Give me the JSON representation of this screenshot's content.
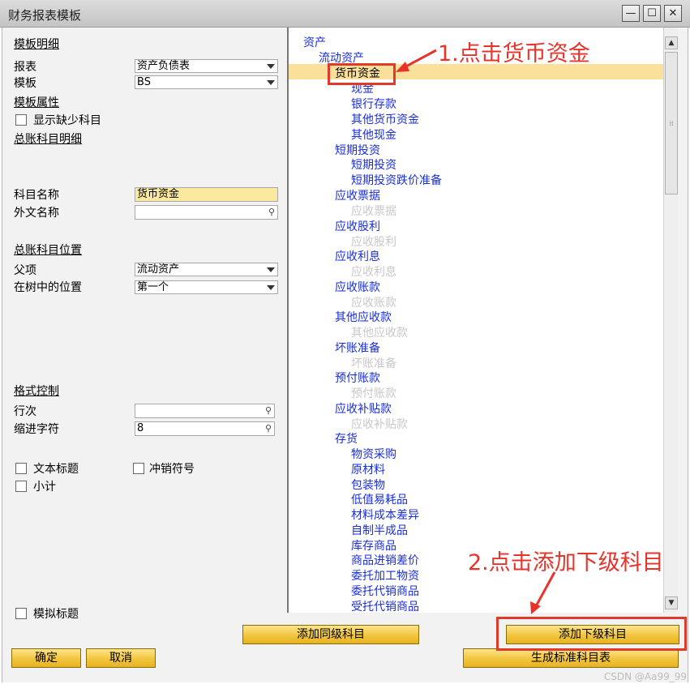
{
  "window": {
    "title": "财务报表模板",
    "minimize_glyph": "—",
    "maximize_glyph": "☐",
    "close_glyph": "✕"
  },
  "left_panel": {
    "template_detail_header": "模板明细",
    "report_label": "报表",
    "report_value": "资产负债表",
    "template_label": "模板",
    "template_value": "BS",
    "template_props_header": "模板属性",
    "show_missing_accounts_label": "显示缺少科目",
    "gl_account_detail_header": "总账科目明细",
    "account_name_label": "科目名称",
    "account_name_value": "货币资金",
    "foreign_name_label": "外文名称",
    "foreign_name_value": "",
    "gl_account_position_header": "总账科目位置",
    "parent_label": "父项",
    "parent_value": "流动资产",
    "tree_position_label": "在树中的位置",
    "tree_position_value": "第一个",
    "format_control_header": "格式控制",
    "row_no_label": "行次",
    "row_no_value": "",
    "indent_label": "缩进字符",
    "indent_value": "8",
    "text_title_label": "文本标题",
    "reversal_sign_label": "冲销符号",
    "subtotal_label": "小计",
    "dummy_title_label": "模拟标题"
  },
  "tree": {
    "root": "资产",
    "current_assets": "流动资产",
    "selected": "货币资金",
    "cash": "现金",
    "bank_deposit": "银行存款",
    "other_monetary": "其他货币资金",
    "other_cash": "其他现金",
    "short_invest": "短期投资",
    "short_invest_child": "短期投资",
    "short_invest_provision": "短期投资跌价准备",
    "notes_receivable": "应收票据",
    "notes_receivable_child": "应收票据",
    "dividends_receivable": "应收股利",
    "dividends_receivable_child": "应收股利",
    "interest_receivable": "应收利息",
    "interest_receivable_child": "应收利息",
    "accounts_receivable": "应收账款",
    "accounts_receivable_child": "应收账款",
    "other_receivables": "其他应收款",
    "other_receivables_child": "其他应收款",
    "bad_debt": "坏账准备",
    "bad_debt_child": "坏账准备",
    "prepayments": "预付账款",
    "prepayments_child": "预付账款",
    "subsidy_receivable": "应收补贴款",
    "subsidy_receivable_child": "应收补贴款",
    "inventory": "存货",
    "material_purchase": "物资采购",
    "raw_materials": "原材料",
    "packaging": "包装物",
    "low_value": "低值易耗品",
    "material_cost_variance": "材料成本差异",
    "self_made_semi": "自制半成品",
    "stock_goods": "库存商品",
    "goods_margin": "商品进销差价",
    "consigned_processing": "委托加工物资",
    "consigned_sales": "委托代销商品",
    "accepted_consignment": "受托代销商品"
  },
  "buttons": {
    "add_same_level": "添加同级科目",
    "add_sub_level": "添加下级科目",
    "ok": "确定",
    "cancel": "取消",
    "generate_standard": "生成标准科目表"
  },
  "annotations": {
    "step1": "1.点击货币资金",
    "step2": "2.点击添加下级科目",
    "color": "#e8332a"
  },
  "watermark": "CSDN @Aa99_99"
}
